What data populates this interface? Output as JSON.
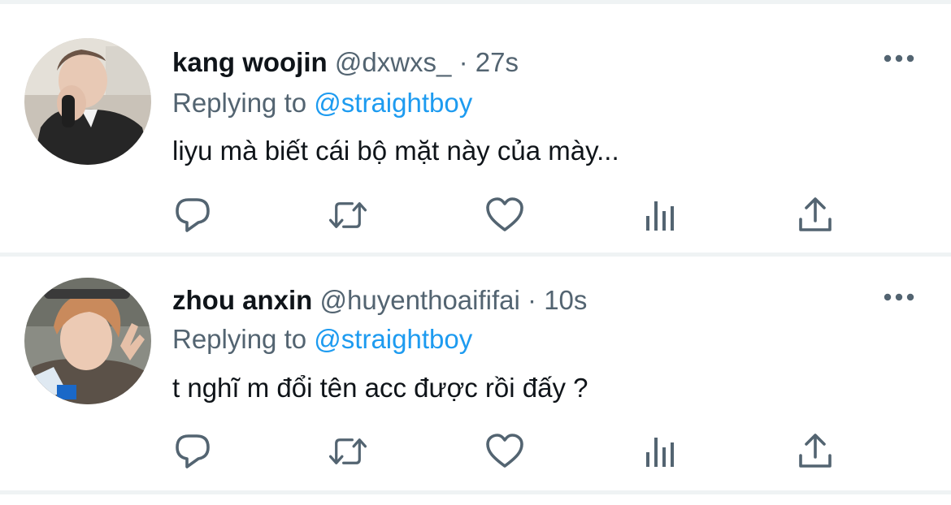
{
  "theme": {
    "text_color": "#0f1419",
    "secondary_color": "#536471",
    "accent_color": "#1d9bf0",
    "separator_color": "#eff3f4"
  },
  "tweets": [
    {
      "display_name": "kang woojin",
      "handle": "@dxwxs_",
      "separator": "·",
      "time": "27s",
      "replying_prefix": "Replying to",
      "replying_to": "@straightboy",
      "text": "liyu mà biết cái bộ mặt này của mày...",
      "icons": [
        "reply-icon",
        "retweet-icon",
        "like-icon",
        "views-icon",
        "share-icon",
        "more-icon"
      ]
    },
    {
      "display_name": "zhou anxin",
      "handle": "@huyenthoaififai",
      "separator": "·",
      "time": "10s",
      "replying_prefix": "Replying to",
      "replying_to": "@straightboy",
      "text": "t nghĩ m đổi tên acc được rồi đấy ?",
      "icons": [
        "reply-icon",
        "retweet-icon",
        "like-icon",
        "views-icon",
        "share-icon",
        "more-icon"
      ]
    }
  ]
}
